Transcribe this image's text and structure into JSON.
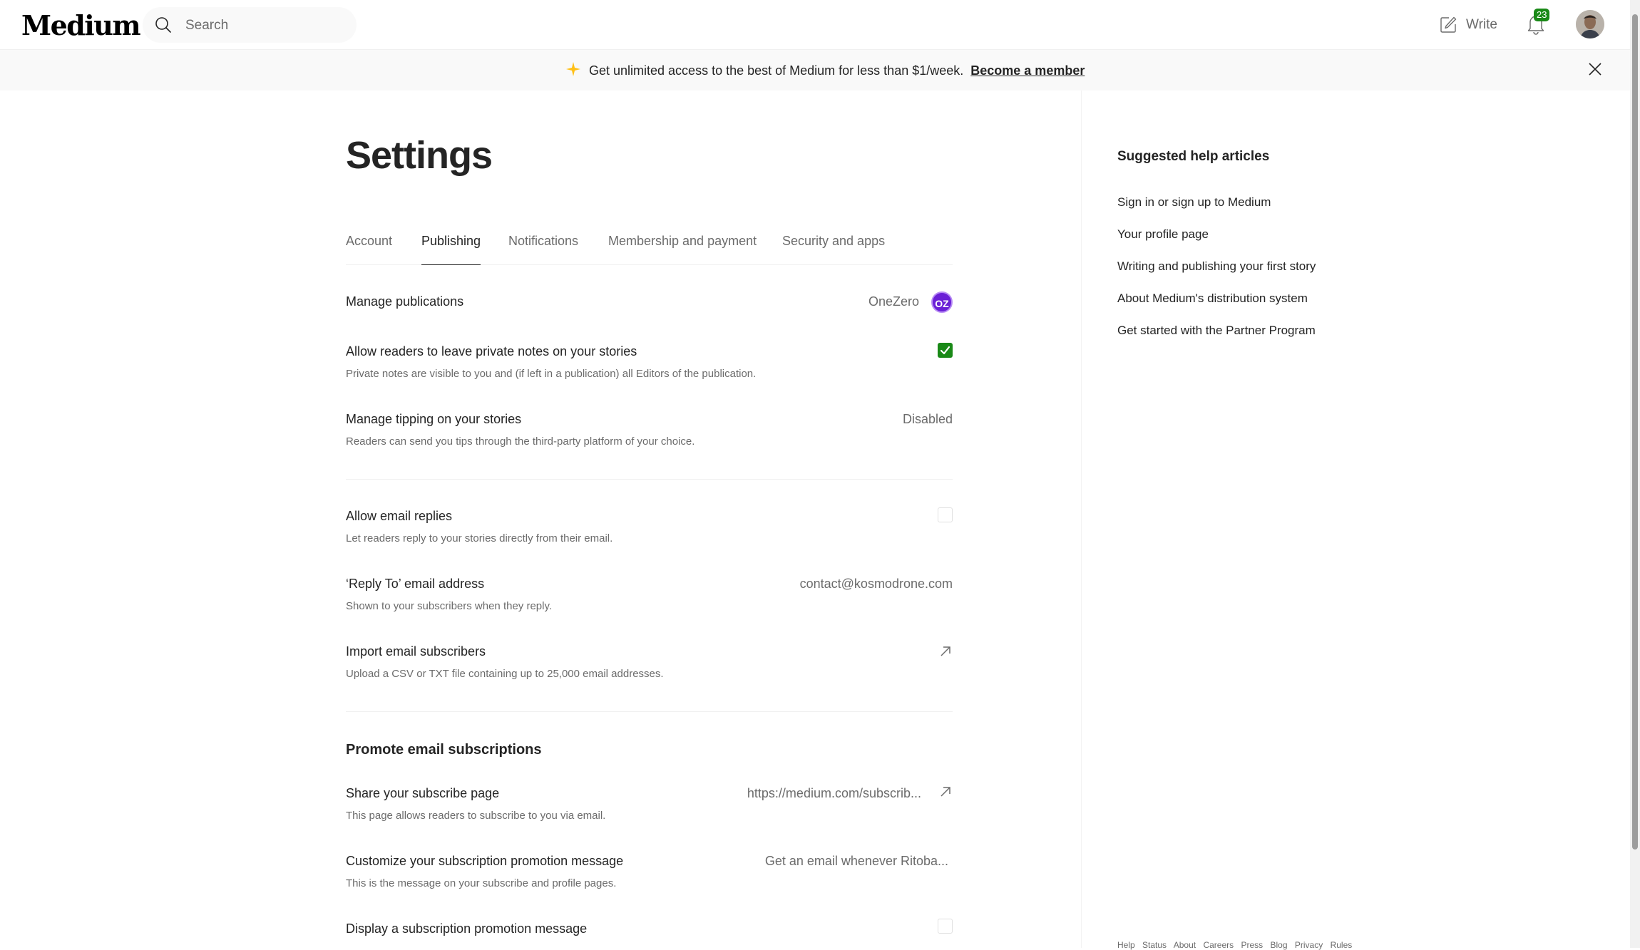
{
  "header": {
    "logo": "Medium",
    "search_placeholder": "Search",
    "write_label": "Write",
    "notifications_count": "23"
  },
  "banner": {
    "text": "Get unlimited access to the best of Medium for less than $1/week.",
    "cta": "Become a member"
  },
  "settings": {
    "title": "Settings",
    "tabs": [
      "Account",
      "Publishing",
      "Notifications",
      "Membership and payment",
      "Security and apps"
    ],
    "active_tab": "Publishing",
    "rows": {
      "manage_publications": {
        "label": "Manage publications",
        "value": "OneZero",
        "logo_text": "OZ"
      },
      "private_notes": {
        "label": "Allow readers to leave private notes on your stories",
        "desc": "Private notes are visible to you and (if left in a publication) all Editors of the publication.",
        "checked": true
      },
      "tipping": {
        "label": "Manage tipping on your stories",
        "desc": "Readers can send you tips through the third-party platform of your choice.",
        "value": "Disabled"
      },
      "email_replies": {
        "label": "Allow email replies",
        "desc": "Let readers reply to your stories directly from their email.",
        "checked": false
      },
      "reply_to": {
        "label": "‘Reply To’ email address",
        "desc": "Shown to your subscribers when they reply.",
        "value": "contact@kosmodrone.com"
      },
      "import_subscribers": {
        "label": "Import email subscribers",
        "desc": "Upload a CSV or TXT file containing up to 25,000 email addresses."
      },
      "promote_section_title": "Promote email subscriptions",
      "subscribe_page": {
        "label": "Share your subscribe page",
        "desc": "This page allows readers to subscribe to you via email.",
        "value": "https://medium.com/subscrib..."
      },
      "promotion_message": {
        "label": "Customize your subscription promotion message",
        "desc": "This is the message on your subscribe and profile pages.",
        "value": "Get an email whenever Ritoba..."
      },
      "display_promotion": {
        "label": "Display a subscription promotion message",
        "checked": false
      }
    }
  },
  "sidebar": {
    "title": "Suggested help articles",
    "links": [
      "Sign in or sign up to Medium",
      "Your profile page",
      "Writing and publishing your first story",
      "About Medium's distribution system",
      "Get started with the Partner Program"
    ],
    "footer": [
      "Help",
      "Status",
      "About",
      "Careers",
      "Press",
      "Blog",
      "Privacy",
      "Rules"
    ]
  },
  "colors": {
    "accent_green": "#1a8917",
    "star_yellow": "#ffc017",
    "publication_purple": "#6a1fd6"
  },
  "icons": [
    "search-icon",
    "write-icon",
    "bell-icon",
    "sparkle-icon",
    "close-icon",
    "external-link-icon",
    "checkmark-icon"
  ]
}
